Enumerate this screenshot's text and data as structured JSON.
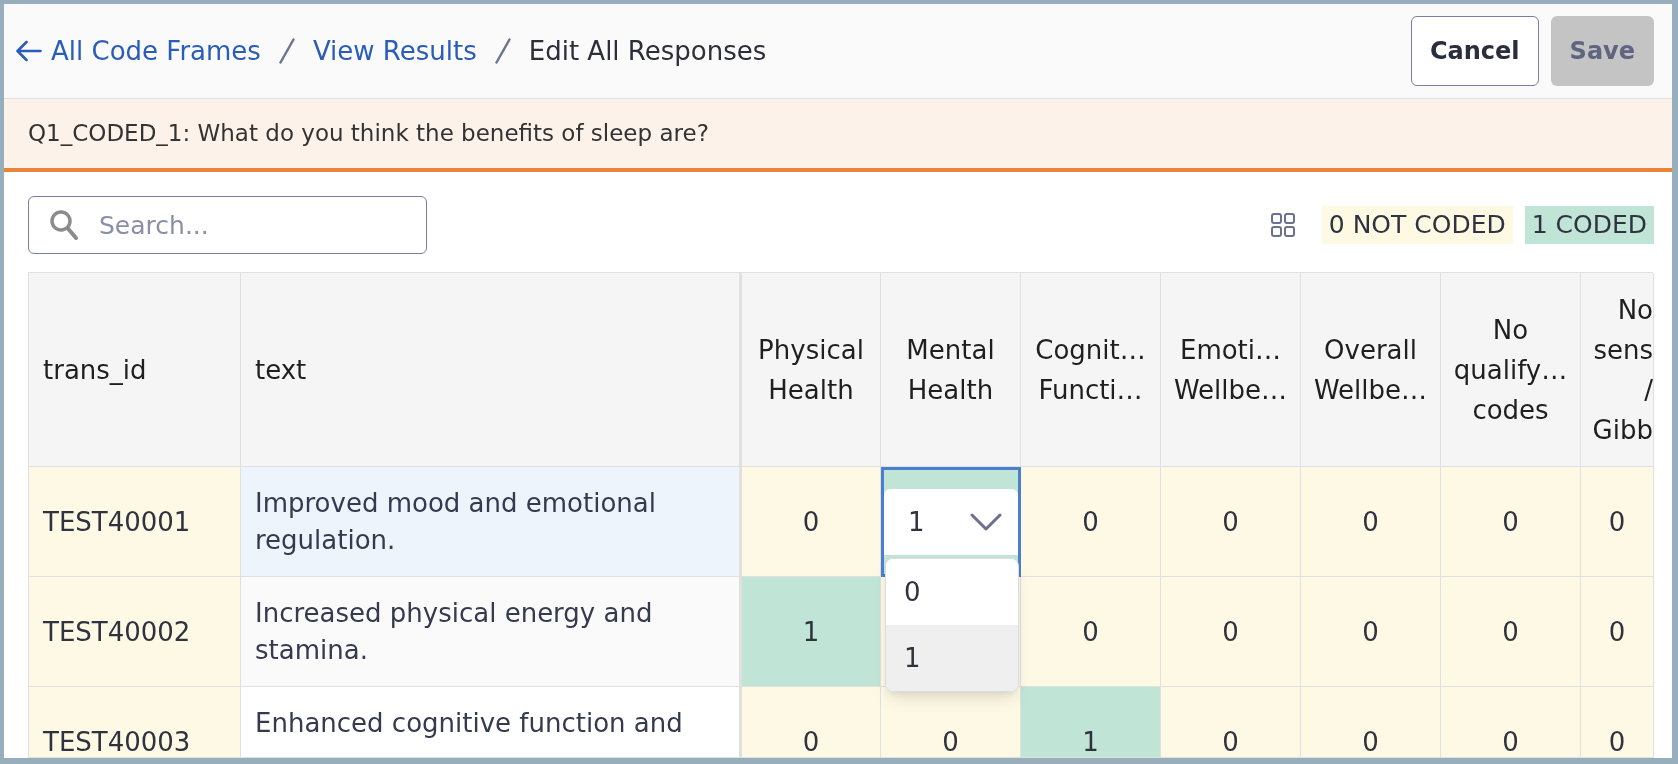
{
  "breadcrumbs": [
    {
      "label": "All Code Frames",
      "kind": "link"
    },
    {
      "label": "View Results",
      "kind": "link"
    },
    {
      "label": "Edit All Responses",
      "kind": "current"
    }
  ],
  "buttons": [
    {
      "label": "Cancel",
      "kind": "secondary",
      "disabled": false
    },
    {
      "label": "Save",
      "kind": "primary",
      "disabled": true
    }
  ],
  "question": "Q1_CODED_1: What do you think the benefits of sleep are?",
  "search": {
    "placeholder": "Search..."
  },
  "legend": [
    {
      "label": "0 NOT CODED",
      "kind": "not_coded"
    },
    {
      "label": "1 CODED",
      "kind": "coded"
    }
  ],
  "table": {
    "columns": [
      {
        "label": "trans_id",
        "kind": "id"
      },
      {
        "label": "text",
        "kind": "text"
      },
      {
        "label": "Physical Health",
        "kind": "code"
      },
      {
        "label": "Mental Health",
        "kind": "code"
      },
      {
        "label": "Cognit… Functi…",
        "kind": "code"
      },
      {
        "label": "Emoti… Wellbe…",
        "kind": "code"
      },
      {
        "label": "Overall Wellbe…",
        "kind": "code"
      },
      {
        "label": "No qualify… codes",
        "kind": "code"
      },
      {
        "label": "No sens / Gibb",
        "kind": "code"
      }
    ],
    "rows": [
      {
        "trans_id": "TEST40001",
        "text": "Improved mood and emotional regulation.",
        "active": true,
        "codes": [
          {
            "value": "0",
            "coded": false,
            "editing": false
          },
          {
            "value": "1",
            "coded": true,
            "editing": true,
            "options": [
              {
                "label": "0",
                "selected": false
              },
              {
                "label": "1",
                "selected": true
              }
            ]
          },
          {
            "value": "0",
            "coded": false,
            "editing": false
          },
          {
            "value": "0",
            "coded": false,
            "editing": false
          },
          {
            "value": "0",
            "coded": false,
            "editing": false
          },
          {
            "value": "0",
            "coded": false,
            "editing": false
          },
          {
            "value": "0",
            "coded": false,
            "editing": false
          }
        ]
      },
      {
        "trans_id": "TEST40002",
        "text": "Increased physical energy and stamina.",
        "active": false,
        "codes": [
          {
            "value": "1",
            "coded": true,
            "editing": false
          },
          {
            "coded": false,
            "editing": false
          },
          {
            "value": "0",
            "coded": false,
            "editing": false
          },
          {
            "value": "0",
            "coded": false,
            "editing": false
          },
          {
            "value": "0",
            "coded": false,
            "editing": false
          },
          {
            "value": "0",
            "coded": false,
            "editing": false
          },
          {
            "value": "0",
            "coded": false,
            "editing": false
          }
        ]
      },
      {
        "trans_id": "TEST40003",
        "text": "Enhanced cognitive function and",
        "active": false,
        "codes": [
          {
            "value": "0",
            "coded": false,
            "editing": false
          },
          {
            "value": "0",
            "coded": false,
            "editing": false
          },
          {
            "value": "1",
            "coded": true,
            "editing": false
          },
          {
            "value": "0",
            "coded": false,
            "editing": false
          },
          {
            "value": "0",
            "coded": false,
            "editing": false
          },
          {
            "value": "0",
            "coded": false,
            "editing": false
          },
          {
            "value": "0",
            "coded": false,
            "editing": false
          }
        ]
      }
    ]
  }
}
